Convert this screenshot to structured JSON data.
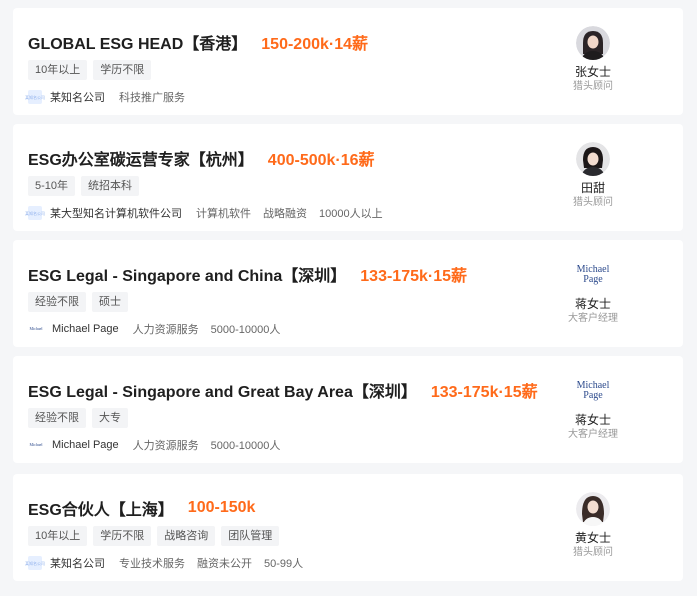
{
  "jobs": [
    {
      "title": "GLOBAL ESG HEAD【香港】",
      "salary": "150-200k·14薪",
      "tags": [
        "10年以上",
        "学历不限"
      ],
      "company": "某知名公司",
      "company_logo": "anonymous-company-logo",
      "meta": [
        "科技推广服务"
      ],
      "recruiter": {
        "name": "张女士",
        "role": "猎头顾问",
        "avatar": "female-portrait"
      }
    },
    {
      "title": "ESG办公室碳运营专家【杭州】",
      "salary": "400-500k·16薪",
      "tags": [
        "5-10年",
        "统招本科"
      ],
      "company": "某大型知名计算机软件公司",
      "company_logo": "anonymous-company-logo",
      "meta": [
        "计算机软件",
        "战略融资",
        "10000人以上"
      ],
      "recruiter": {
        "name": "田甜",
        "role": "猎头顾问",
        "avatar": "female-portrait"
      }
    },
    {
      "title": "ESG Legal - Singapore and China【深圳】",
      "salary": "133-175k·15薪",
      "tags": [
        "经验不限",
        "硕士"
      ],
      "company": "Michael Page",
      "company_logo": "michael-page-logo",
      "meta": [
        "人力资源服务",
        "5000-10000人"
      ],
      "recruiter": {
        "name": "蒋女士",
        "role": "大客户经理",
        "avatar": "michael-page-logo"
      }
    },
    {
      "title": "ESG Legal - Singapore and Great Bay Area【深圳】",
      "salary": "133-175k·15薪",
      "tags": [
        "经验不限",
        "大专"
      ],
      "company": "Michael Page",
      "company_logo": "michael-page-logo",
      "meta": [
        "人力资源服务",
        "5000-10000人"
      ],
      "recruiter": {
        "name": "蒋女士",
        "role": "大客户经理",
        "avatar": "michael-page-logo"
      }
    },
    {
      "title": "ESG合伙人【上海】",
      "salary": "100-150k",
      "tags": [
        "10年以上",
        "学历不限",
        "战略咨询",
        "团队管理"
      ],
      "company": "某知名公司",
      "company_logo": "anonymous-company-logo",
      "meta": [
        "专业技术服务",
        "融资未公开",
        "50-99人"
      ],
      "recruiter": {
        "name": "黄女士",
        "role": "猎头顾问",
        "avatar": "female-portrait"
      }
    }
  ],
  "logos": {
    "anon_text": "某知名公司",
    "mp_line1": "Michael",
    "mp_line2": "Page"
  },
  "colors": {
    "salary": "#ff6a1a",
    "card_bg": "#ffffff",
    "page_bg": "#f5f6f8",
    "tag_bg": "#f3f4f6"
  }
}
